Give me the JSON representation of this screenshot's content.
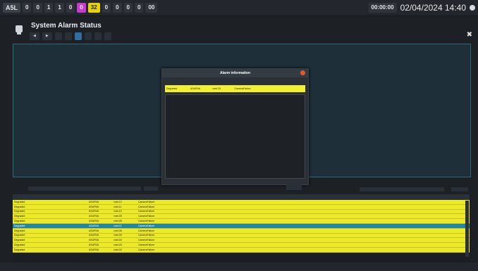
{
  "topbar": {
    "logo": "A5L",
    "chips": [
      "0",
      "0",
      "1",
      "1",
      "0",
      "0",
      "32",
      "0",
      "0",
      "0",
      "0",
      "00"
    ],
    "pink_count": "0",
    "yellow_count": "32",
    "right_chips": [
      "00:00:00"
    ],
    "datetime": "02/04/2024 14:40"
  },
  "header": {
    "title": "System Alarm Status",
    "tabs": [
      "",
      "",
      "",
      "",
      "",
      "",
      "",
      ""
    ]
  },
  "textpanel": {
    "text": ""
  },
  "modal": {
    "title": "Alarm information",
    "columns": [
      "",
      "",
      "",
      "",
      ""
    ],
    "row": {
      "priority": "Degraded",
      "subsystem": "ASURVA",
      "equipment": "vnet-33",
      "alert": "CameraFailure",
      "description": ""
    },
    "details_label": "",
    "details": ""
  },
  "filterbar": {
    "label": "",
    "left_button": "",
    "clear_button": "",
    "search_placeholder": "",
    "right_button": ""
  },
  "table": {
    "columns": [
      "",
      "",
      "",
      "",
      "",
      "",
      "",
      "",
      ""
    ],
    "rows": [
      {
        "priority": "Degraded",
        "time": "",
        "location": "",
        "subsystem": "ASURVA",
        "equipment": "vnet-12",
        "alert": "CameraFailure",
        "description": "",
        "ack_time": "",
        "ack_by": "",
        "selected": false
      },
      {
        "priority": "Degraded",
        "time": "",
        "location": "",
        "subsystem": "ASURVA",
        "equipment": "vnet-11",
        "alert": "CameraFailure",
        "description": "",
        "ack_time": "",
        "ack_by": "",
        "selected": false
      },
      {
        "priority": "Degraded",
        "time": "",
        "location": "",
        "subsystem": "ASURVA",
        "equipment": "vnet-10",
        "alert": "CameraFailure",
        "description": "",
        "ack_time": "",
        "ack_by": "",
        "selected": false
      },
      {
        "priority": "Degraded",
        "time": "",
        "location": "",
        "subsystem": "ASURVA",
        "equipment": "vnet-09",
        "alert": "CameraFailure",
        "description": "",
        "ack_time": "",
        "ack_by": "",
        "selected": false
      },
      {
        "priority": "Degraded",
        "time": "",
        "location": "",
        "subsystem": "ASURVA",
        "equipment": "vnet-08",
        "alert": "CameraFailure",
        "description": "",
        "ack_time": "",
        "ack_by": "",
        "selected": false
      },
      {
        "priority": "Degraded",
        "time": "",
        "location": "",
        "subsystem": "ASURVA",
        "equipment": "vnet-07",
        "alert": "CameraFailure",
        "description": "",
        "ack_time": "",
        "ack_by": "",
        "selected": true
      },
      {
        "priority": "Degraded",
        "time": "",
        "location": "",
        "subsystem": "ASURVA",
        "equipment": "vnet-06",
        "alert": "CameraFailure",
        "description": "",
        "ack_time": "",
        "ack_by": "",
        "selected": false
      },
      {
        "priority": "Degraded",
        "time": "",
        "location": "",
        "subsystem": "ASURVA",
        "equipment": "vnet-05",
        "alert": "CameraFailure",
        "description": "",
        "ack_time": "",
        "ack_by": "",
        "selected": false
      },
      {
        "priority": "Degraded",
        "time": "",
        "location": "",
        "subsystem": "ASURVA",
        "equipment": "vnet-04",
        "alert": "CameraFailure",
        "description": "",
        "ack_time": "",
        "ack_by": "",
        "selected": false
      },
      {
        "priority": "Degraded",
        "time": "",
        "location": "",
        "subsystem": "ASURVA",
        "equipment": "vnet-03",
        "alert": "CameraFailure",
        "description": "",
        "ack_time": "",
        "ack_by": "",
        "selected": false
      },
      {
        "priority": "Degraded",
        "time": "",
        "location": "",
        "subsystem": "ASURVA",
        "equipment": "vnet-02",
        "alert": "CameraFailure",
        "description": "",
        "ack_time": "",
        "ack_by": "",
        "selected": false
      }
    ]
  },
  "bottombar": {
    "buttons": [
      "",
      "",
      "",
      "",
      "",
      ""
    ],
    "right_button": ""
  },
  "colors": {
    "degraded": "#ece82a",
    "selected": "#1f86a8",
    "accent": "#2f6fa3"
  }
}
